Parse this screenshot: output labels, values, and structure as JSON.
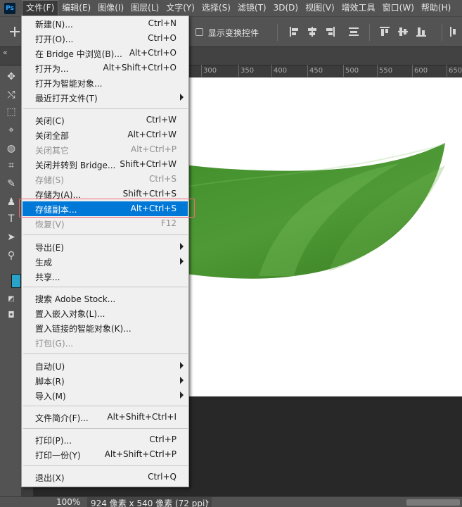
{
  "app": {
    "logo": "Ps"
  },
  "menubar": {
    "items": [
      {
        "label": "文件(F)",
        "active": true
      },
      {
        "label": "编辑(E)"
      },
      {
        "label": "图像(I)"
      },
      {
        "label": "图层(L)"
      },
      {
        "label": "文字(Y)"
      },
      {
        "label": "选择(S)"
      },
      {
        "label": "滤镜(T)"
      },
      {
        "label": "3D(D)"
      },
      {
        "label": "视图(V)"
      },
      {
        "label": "增效工具"
      },
      {
        "label": "窗口(W)"
      },
      {
        "label": "帮助(H)"
      }
    ]
  },
  "options_bar": {
    "show_transform_controls": "显示变换控件",
    "checked": false
  },
  "ruler": {
    "labels": [
      "300",
      "350",
      "400",
      "450",
      "500",
      "550",
      "600",
      "650"
    ]
  },
  "file_menu": {
    "items": [
      {
        "label": "新建(N)...",
        "shortcut": "Ctrl+N"
      },
      {
        "label": "打开(O)...",
        "shortcut": "Ctrl+O"
      },
      {
        "label": "在 Bridge 中浏览(B)...",
        "shortcut": "Alt+Ctrl+O"
      },
      {
        "label": "打开为...",
        "shortcut": "Alt+Shift+Ctrl+O"
      },
      {
        "label": "打开为智能对象...",
        "shortcut": ""
      },
      {
        "label": "最近打开文件(T)",
        "shortcut": "",
        "submenu": true
      },
      {
        "label": "关闭(C)",
        "shortcut": "Ctrl+W"
      },
      {
        "label": "关闭全部",
        "shortcut": "Alt+Ctrl+W"
      },
      {
        "label": "关闭其它",
        "shortcut": "Alt+Ctrl+P",
        "disabled": true
      },
      {
        "label": "关闭并转到 Bridge...",
        "shortcut": "Shift+Ctrl+W"
      },
      {
        "label": "存储(S)",
        "shortcut": "Ctrl+S",
        "disabled": true
      },
      {
        "label": "存储为(A)...",
        "shortcut": "Shift+Ctrl+S"
      },
      {
        "label": "存储副本...",
        "shortcut": "Alt+Ctrl+S",
        "highlighted": true
      },
      {
        "label": "恢复(V)",
        "shortcut": "F12",
        "disabled": true
      },
      {
        "label": "导出(E)",
        "shortcut": "",
        "submenu": true
      },
      {
        "label": "生成",
        "shortcut": "",
        "submenu": true
      },
      {
        "label": "共享...",
        "shortcut": ""
      },
      {
        "label": "搜索 Adobe Stock...",
        "shortcut": ""
      },
      {
        "label": "置入嵌入对象(L)...",
        "shortcut": ""
      },
      {
        "label": "置入链接的智能对象(K)...",
        "shortcut": ""
      },
      {
        "label": "打包(G)...",
        "shortcut": "",
        "disabled": true
      },
      {
        "label": "自动(U)",
        "shortcut": "",
        "submenu": true
      },
      {
        "label": "脚本(R)",
        "shortcut": "",
        "submenu": true
      },
      {
        "label": "导入(M)",
        "shortcut": "",
        "submenu": true
      },
      {
        "label": "文件简介(F)...",
        "shortcut": "Alt+Shift+Ctrl+I"
      },
      {
        "label": "打印(P)...",
        "shortcut": "Ctrl+P"
      },
      {
        "label": "打印一份(Y)",
        "shortcut": "Alt+Shift+Ctrl+P"
      },
      {
        "label": "退出(X)",
        "shortcut": "Ctrl+Q"
      }
    ]
  },
  "status": {
    "zoom": "100%",
    "doc_info": "924 像素 x 540 像素 (72 ppi)",
    "arrow": "›"
  },
  "colors": {
    "foreground": "#2aa3c8",
    "highlight": "#0078d7",
    "leaf": "#3f8a2a"
  }
}
